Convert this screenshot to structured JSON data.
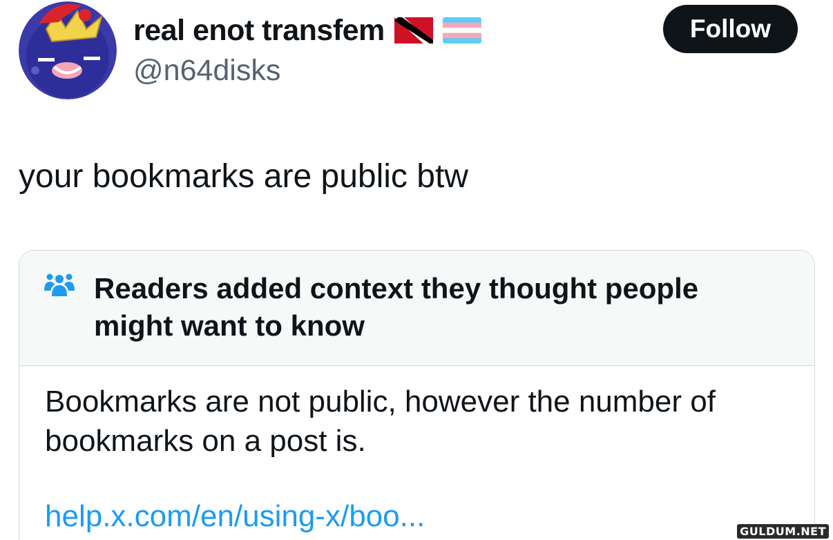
{
  "author": {
    "display_name": "real enot transfem",
    "handle": "@n64disks",
    "flags": [
      "trinidad-and-tobago-flag-icon",
      "transgender-flag-icon"
    ]
  },
  "follow_button": {
    "label": "Follow"
  },
  "tweet": {
    "text": "your bookmarks are public btw"
  },
  "community_note": {
    "icon": "people-group-icon",
    "title": "Readers added context they thought people might want to know",
    "body": "Bookmarks are not public, however the number of bookmarks on a post is.",
    "link": "help.x.com/en/using-x/boo..."
  },
  "watermark": "GULDUM.NET",
  "colors": {
    "text_primary": "#0f1419",
    "text_secondary": "#536471",
    "link": "#1d9bf0",
    "note_header_bg": "#f7f9f9",
    "border": "#cfd9de"
  }
}
